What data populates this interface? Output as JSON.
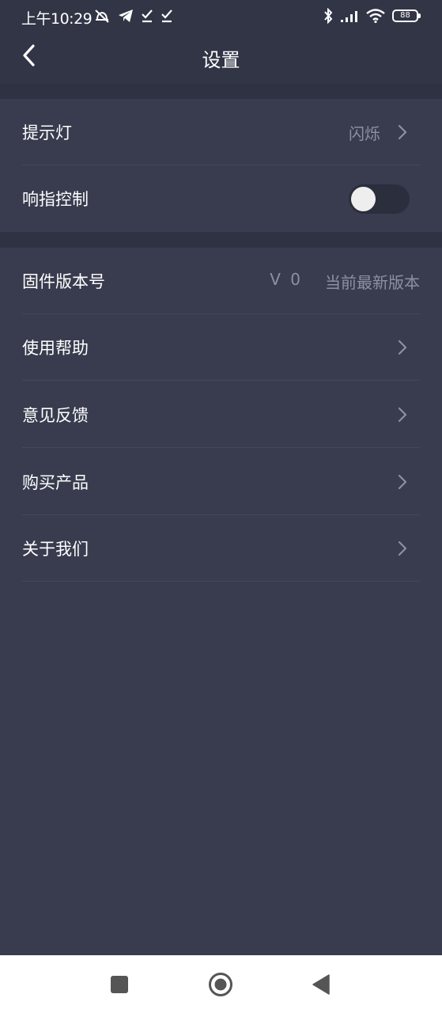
{
  "status_bar": {
    "time": "上午10:29",
    "battery": "88",
    "icons": [
      "alarm-off-icon",
      "telegram-icon",
      "check-icon",
      "check-icon",
      "bluetooth-icon",
      "signal-icon",
      "wifi-icon",
      "battery-icon"
    ]
  },
  "header": {
    "title": "设置",
    "back_icon": "chevron-left-icon"
  },
  "section1": {
    "rows": [
      {
        "label": "提示灯",
        "value": "闪烁"
      },
      {
        "label": "响指控制",
        "toggle_on": false
      }
    ]
  },
  "section2": {
    "firmware": {
      "label": "固件版本号",
      "version": "V 0",
      "status": "当前最新版本"
    },
    "rows": [
      {
        "label": "使用帮助"
      },
      {
        "label": "意见反馈"
      },
      {
        "label": "购买产品"
      },
      {
        "label": "关于我们"
      }
    ]
  },
  "nav_bar": {
    "icons": [
      "recents-square-icon",
      "home-circle-icon",
      "back-triangle-icon"
    ]
  },
  "colors": {
    "background": "#383c4e",
    "header": "#323546",
    "secondary_text": "#8d90a0"
  }
}
